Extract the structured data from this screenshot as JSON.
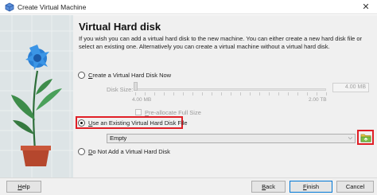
{
  "window": {
    "title": "Create Virtual Machine",
    "close_glyph": "✕"
  },
  "page": {
    "heading": "Virtual Hard disk",
    "description": "If you wish you can add a virtual hard disk to the new machine. You can either create a new hard disk file or select an existing one. Alternatively you can create a virtual machine without a virtual hard disk."
  },
  "options": {
    "create_new": {
      "mnemonic": "C",
      "rest": "reate a Virtual Hard Disk Now",
      "selected": false
    },
    "use_existing": {
      "mnemonic": "U",
      "rest": "se an Existing Virtual Hard Disk File",
      "selected": true
    },
    "no_disk": {
      "mnemonic": "D",
      "rest": "o Not Add a Virtual Hard Disk",
      "selected": false
    }
  },
  "disk_size": {
    "label": "Disk Size:",
    "value": "4.00 MB",
    "min_label": "4.00 MB",
    "max_label": "2.00 TB",
    "enabled": false
  },
  "preallocate": {
    "mnemonic": "P",
    "rest": "re-allocate Full Size",
    "checked": false,
    "enabled": false
  },
  "existing_file": {
    "selected": "Empty"
  },
  "buttons": {
    "help": {
      "mnemonic": "H",
      "rest": "elp"
    },
    "back": {
      "mnemonic": "B",
      "rest": "ack"
    },
    "finish": {
      "mnemonic": "F",
      "rest": "inish"
    },
    "cancel": "Cancel"
  },
  "colors": {
    "highlight": "#e01f26",
    "accent": "#0078d7",
    "folder": "#7cc047"
  },
  "icons": {
    "app": "virtualbox-icon",
    "close": "close-icon",
    "dropdown": "chevron-down-icon",
    "browse": "folder-icon"
  }
}
